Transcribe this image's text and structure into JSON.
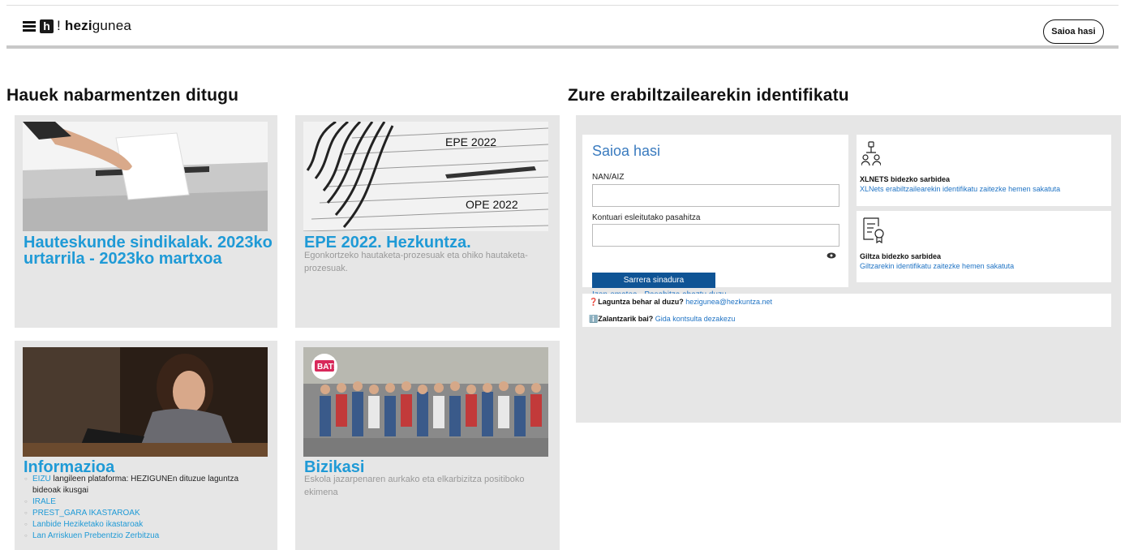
{
  "header": {
    "logo_mark": "h",
    "logo_bang": "!",
    "logo_bold": "hezi",
    "logo_rest": "gunea",
    "login_button": "Saioa hasi"
  },
  "highlights": {
    "title": "Hauek nabarmentzen ditugu",
    "cards": [
      {
        "title": "Hauteskunde sindikalak. 2023ko urtarrila - 2023ko martxoa",
        "desc": ""
      },
      {
        "title": "EPE 2022. Hezkuntza.",
        "desc": "Egonkortzeko hautaketa-prozesuak eta ohiko hautaketa-prozesuak.",
        "img_text_1": "EPE 2022",
        "img_text_2": "OPE 2022"
      },
      {
        "title": "Informazioa",
        "items": [
          {
            "link": "EIZU",
            "text": " langileen plataforma: HEZIGUNEn dituzue laguntza bideoak ikusgai"
          },
          {
            "link": "IRALE",
            "text": ""
          },
          {
            "link": "PREST_GARA IKASTAROAK",
            "text": ""
          },
          {
            "link": "Lanbide Heziketako ikastaroak",
            "text": ""
          },
          {
            "link": "Lan Arriskuen Prebentzio Zerbitzua",
            "text": ""
          }
        ]
      },
      {
        "title": "Bizikasi",
        "desc": "Eskola jazarpenaren aurkako eta elkarbizitza positiboko ekimena",
        "badge": "BAT!"
      }
    ]
  },
  "login": {
    "title": "Zure erabiltzailearekin identifikatu",
    "box_title": "Saioa hasi",
    "user_label": "NAN/AIZ",
    "user_value": "",
    "pass_label": "Kontuari esleitutako pasahitza",
    "pass_value": "",
    "submit": "Sarrera sinadura",
    "register_link": "Izen-ematea",
    "forgot_link": "Pasahitza ahaztu duzu",
    "xlnets_title": "XLNETS bidezko sarbidea",
    "xlnets_sub": "XLNets erabiltzailearekin identifikatu zaitezke hemen sakatuta",
    "giltza_title": "Giltza bidezko sarbidea",
    "giltza_sub": "Giltzarekin identifikatu zaitezke hemen sakatuta",
    "help_q": "Laguntza behar al duzu?",
    "help_email": "hezigunea@hezkuntza.net",
    "doubt_q": "Zalantzarik bai?",
    "doubt_link": "Gida kontsulta dezakezu"
  },
  "colors": {
    "accent": "#1f9ad6",
    "button": "#0f5495",
    "panel": "#e6e6e6"
  }
}
